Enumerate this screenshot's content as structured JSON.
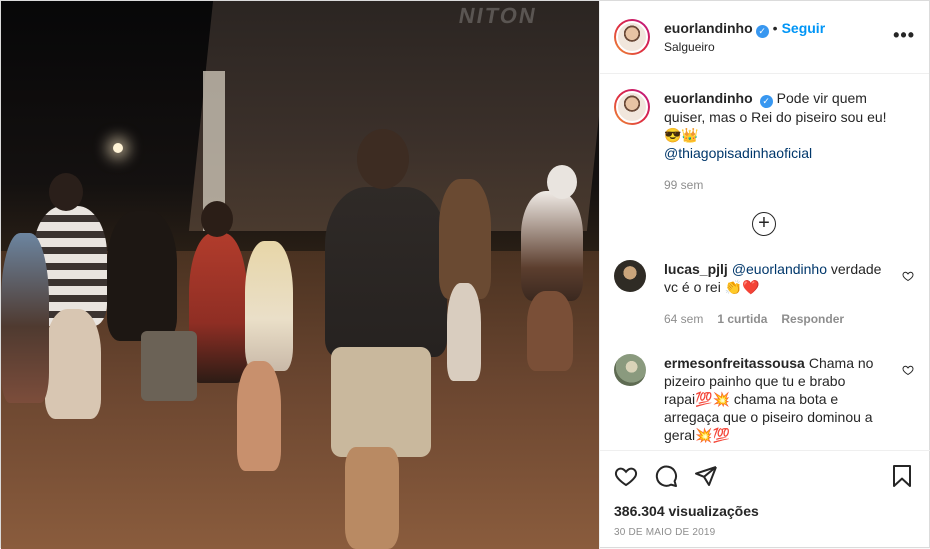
{
  "media": {
    "sign_text": "NITON"
  },
  "header": {
    "username": "euorlandinho",
    "verified_mark": "✓",
    "separator": "•",
    "follow_label": "Seguir",
    "location": "Salgueiro",
    "more_icon": "more-horizontal-icon",
    "more_glyph": "•••"
  },
  "caption": {
    "username": "euorlandinho",
    "text": "Pode vir quem quiser, mas o Rei do piseiro sou eu! 😎👑",
    "mention": "@thiagopisadinhaoficial",
    "time": "99 sem"
  },
  "load_more": {
    "glyph": "+"
  },
  "comments": [
    {
      "username": "lucas_pjlj",
      "mention": "@euorlandinho",
      "text": "verdade vc é o rei 👏❤️",
      "time": "64 sem",
      "likes": "1 curtida",
      "reply": "Responder",
      "avatar_color": "#3b3a34"
    },
    {
      "username": "ermesonfreitassousa",
      "mention": "",
      "text": "Chama no pizeiro painho que tu e brabo rapai💯💥 chama na bota e arregaça que o piseiro dominou a geral💥💯",
      "avatar_color": "#7b8a72"
    }
  ],
  "actions": {
    "icons": [
      "heart-icon",
      "comment-icon",
      "share-icon",
      "bookmark-icon"
    ]
  },
  "stats": {
    "views": "386.304 visualizações",
    "date": "30 DE MAIO DE 2019"
  },
  "colors": {
    "accent": "#0095f6",
    "verified": "#3897f0",
    "mention": "#00376b",
    "muted": "#8e8e8e"
  }
}
